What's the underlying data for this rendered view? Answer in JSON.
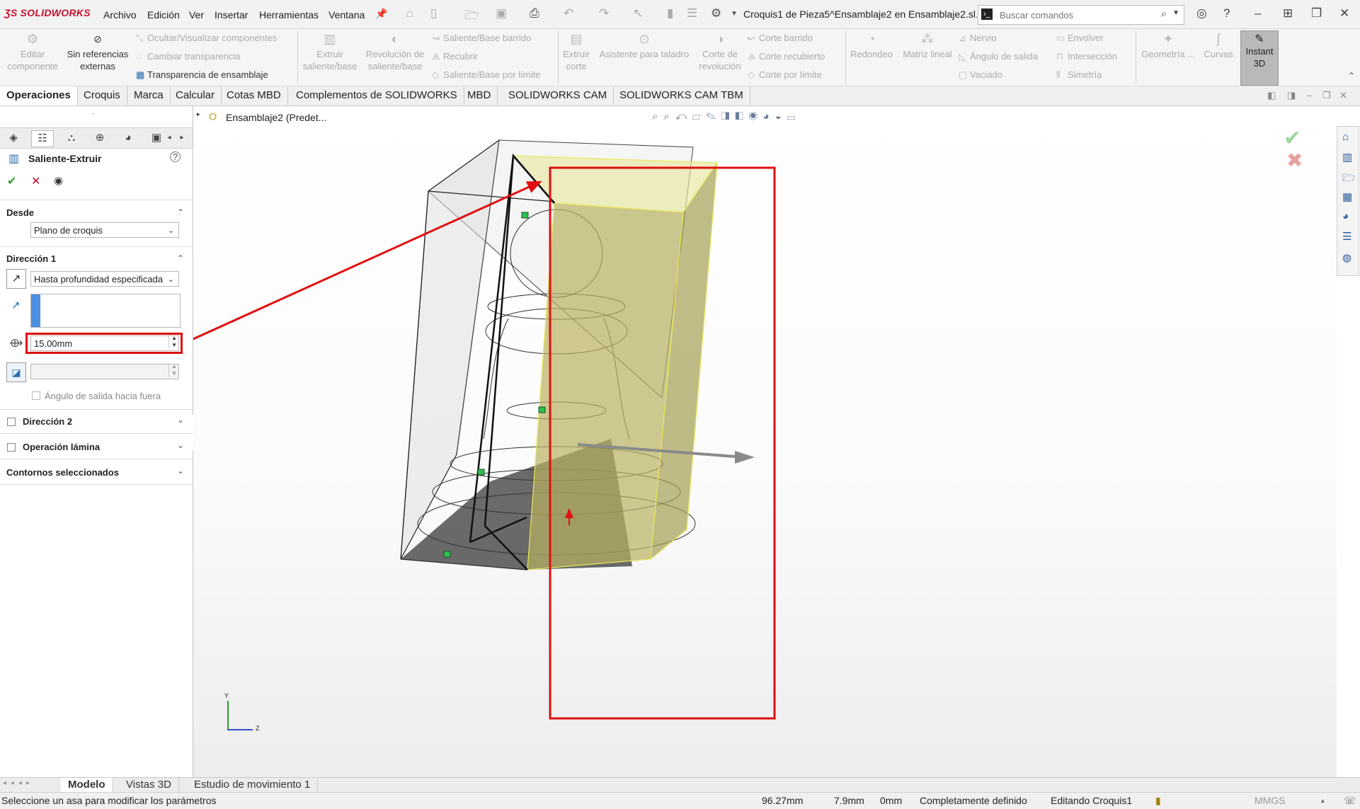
{
  "app": {
    "logo": "SOLIDWORKS",
    "document_title": "Croquis1 de Pieza5^Ensamblaje2 en Ensamblaje2.sl..."
  },
  "menu": [
    "Archivo",
    "Edición",
    "Ver",
    "Insertar",
    "Herramientas",
    "Ventana"
  ],
  "search": {
    "placeholder": "Buscar comandos"
  },
  "command_manager": {
    "editar_componente": "Editar componente",
    "sin_referencias": "Sin referencias externas",
    "ocultar": "Ocultar/Visualizar componentes",
    "cambiar_transparencia": "Cambiar transparencia",
    "transparencia_ensamblaje": "Transparencia de ensamblaje",
    "extruir": "Extruir saliente/base",
    "revolucion": "Revolución de saliente/base",
    "saliente_barrido": "Saliente/Base barrido",
    "recubrir": "Recubrir",
    "saliente_limite": "Saliente/Base por límite",
    "extruir_corte": "Extruir corte",
    "asistente_taladro": "Asistente para taladro",
    "corte_revolucion": "Corte de revolución",
    "corte_barrido": "Corte barrido",
    "corte_recubierto": "Corte recubierto",
    "corte_limite": "Corte por límite",
    "redondeo": "Redondeo",
    "matriz_lineal": "Matriz lineal",
    "nervio": "Nervio",
    "angulo_salida": "Ángulo de salida",
    "vaciado": "Vaciado",
    "envolver": "Envolver",
    "interseccion": "Intersección",
    "simetria": "Simetría",
    "geometria": "Geometría ...",
    "curvas": "Curvas",
    "instant3d": "Instant 3D"
  },
  "tabs": [
    "Operaciones",
    "Croquis",
    "Marca",
    "Calcular",
    "Cotas MBD",
    "Complementos de SOLIDWORKS",
    "MBD",
    "SOLIDWORKS CAM",
    "SOLIDWORKS CAM TBM"
  ],
  "feature_tree": {
    "root": "Ensamblaje2  (Predet..."
  },
  "property_manager": {
    "title": "Saliente-Extruir",
    "desde": {
      "label": "Desde",
      "value": "Plano de croquis"
    },
    "direccion1": {
      "label": "Dirección 1",
      "end_condition": "Hasta profundidad especificada",
      "depth": "15.00mm",
      "draft_label": "Ángulo de salida hacia fuera"
    },
    "direccion2": "Dirección 2",
    "operacion_lamina": "Operación lámina",
    "contornos": "Contornos seleccionados"
  },
  "bottom_tabs": [
    "Modelo",
    "Vistas 3D",
    "Estudio de movimiento 1"
  ],
  "status": {
    "message": "Seleccione un asa para modificar los parámetros",
    "x": "96.27mm",
    "y": "7.9mm",
    "z": "0mm",
    "state": "Completamente definido",
    "editing": "Editando Croquis1",
    "units": "MMGS"
  },
  "triad": {
    "y": "Y",
    "z": "Z"
  },
  "colors": {
    "accent": "#c8102e",
    "highlight": "#e01010",
    "extrude_fill": "#c8c27a",
    "extrude_edge": "#e8e85a"
  }
}
